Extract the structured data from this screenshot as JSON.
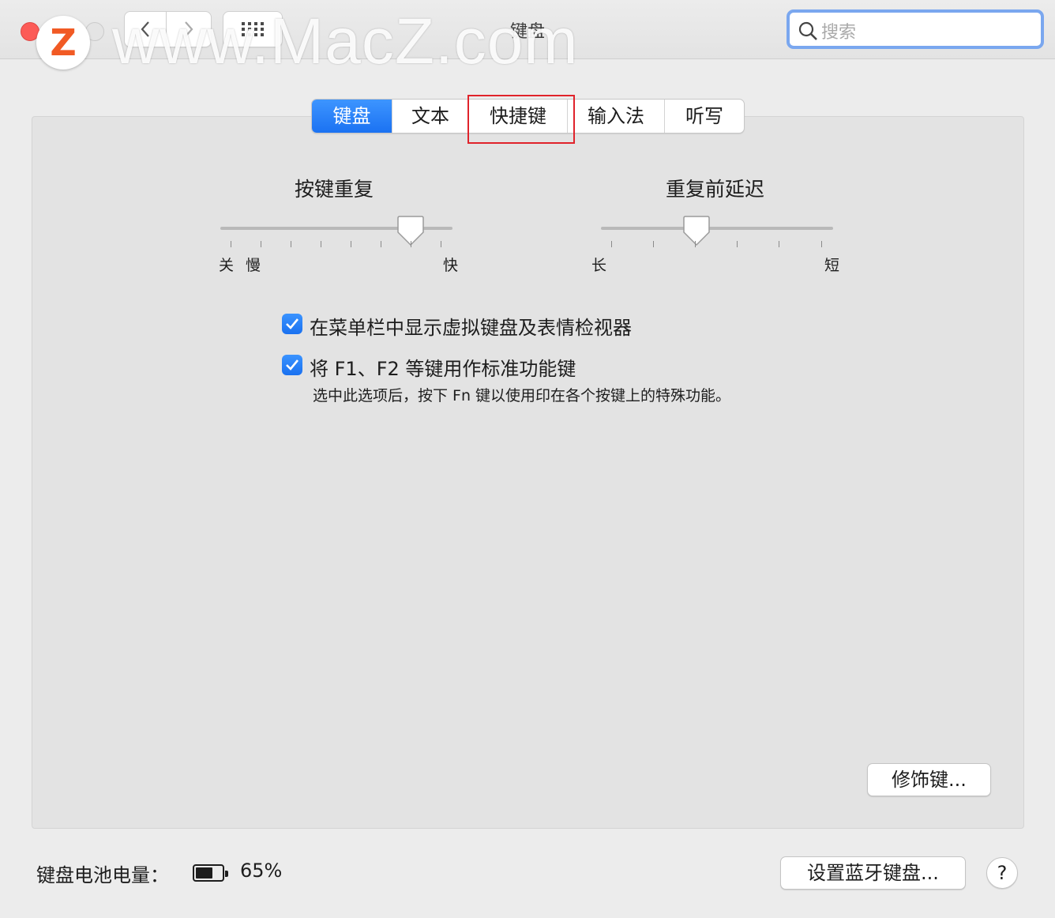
{
  "window": {
    "title": "键盘"
  },
  "watermark": {
    "logo_letter": "Z",
    "text": "www.MacZ.com"
  },
  "search": {
    "placeholder": "搜索"
  },
  "tabs": [
    {
      "label": "键盘",
      "active": true
    },
    {
      "label": "文本",
      "active": false
    },
    {
      "label": "快捷键",
      "active": false
    },
    {
      "label": "输入法",
      "active": false
    },
    {
      "label": "听写",
      "active": false
    }
  ],
  "key_repeat": {
    "title": "按键重复",
    "label_off": "关",
    "label_slow": "慢",
    "label_fast": "快",
    "level": 0.82
  },
  "delay_until_repeat": {
    "title": "重复前延迟",
    "label_long": "长",
    "label_short": "短",
    "level": 0.41
  },
  "options": [
    {
      "label": "在菜单栏中显示虚拟键盘及表情检视器",
      "checked": true
    },
    {
      "label": "将 F1、F2 等键用作标准功能键",
      "checked": true,
      "description": "选中此选项后，按下 Fn 键以使用印在各个按键上的特殊功能。"
    }
  ],
  "buttons": {
    "modifier_keys": "修饰键...",
    "setup_bluetooth": "设置蓝牙键盘...",
    "help": "?"
  },
  "battery": {
    "label": "键盘电池电量：",
    "percent_text": "65%",
    "level": 0.65
  },
  "colors": {
    "accent": "#1b72f2",
    "highlight_border": "#e0232b",
    "close_button": "#fc5b57"
  }
}
